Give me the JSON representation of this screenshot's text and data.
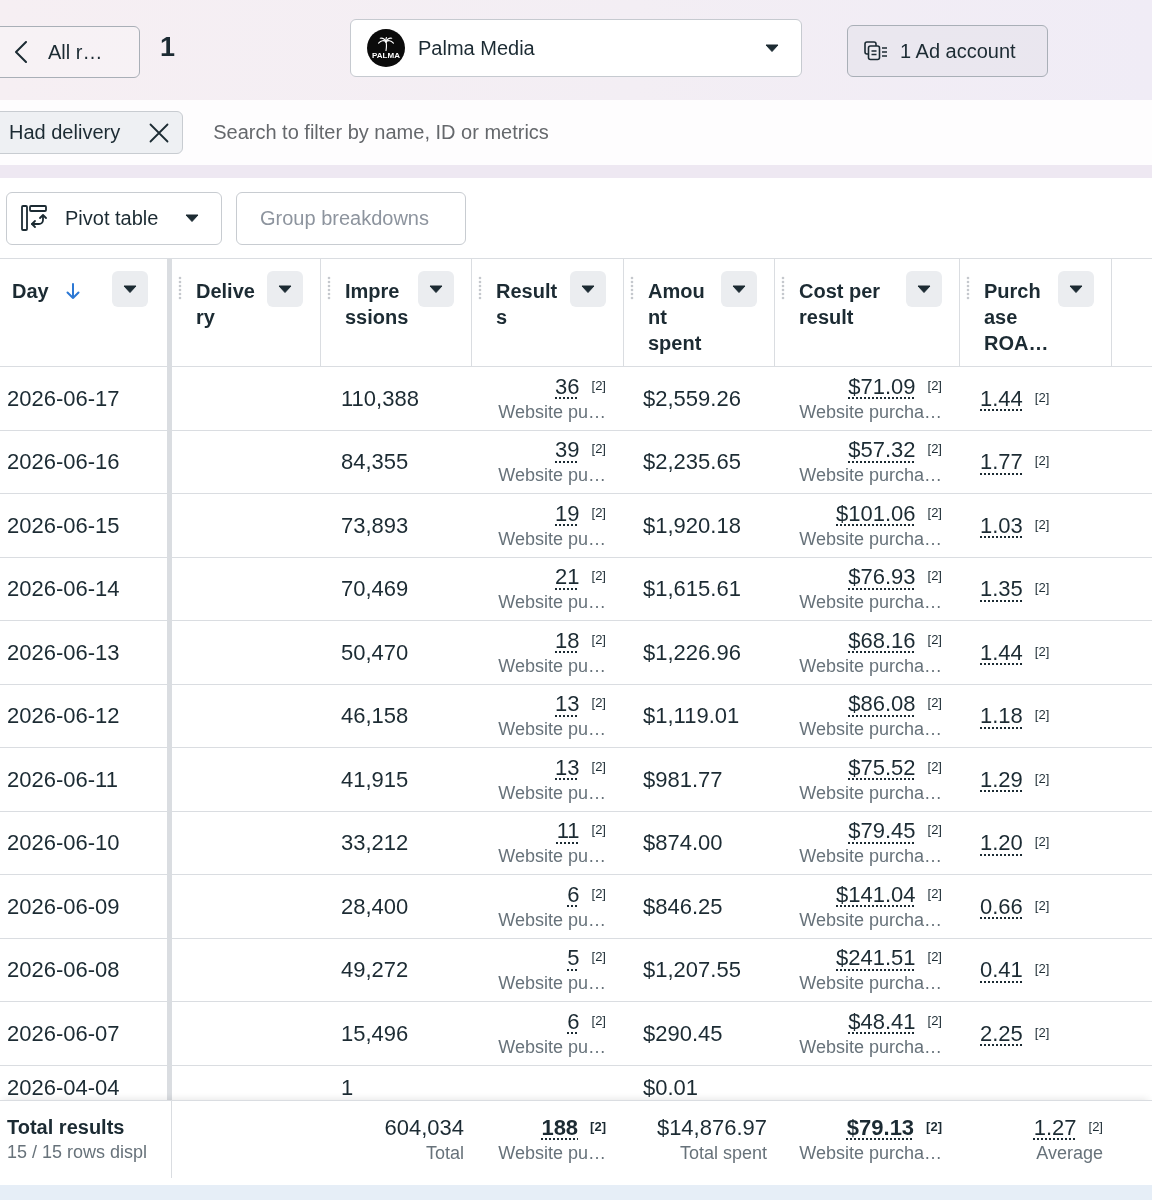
{
  "top_bar": {
    "back_button": {
      "label": "All r…"
    },
    "count": "1",
    "account_picker": {
      "logo_text": "PALMA",
      "name": "Palma Media"
    },
    "ad_account_button": {
      "label": "1 Ad account"
    }
  },
  "filter_bar": {
    "chips": [
      {
        "label": "Had delivery"
      }
    ],
    "search": {
      "placeholder": "Search to filter by name, ID or metrics"
    }
  },
  "toolbar": {
    "pivot_button": {
      "label": "Pivot table"
    },
    "group_button": {
      "label": "Group breakdowns",
      "disabled": true
    }
  },
  "table": {
    "columns": [
      {
        "label": "Day",
        "sorted_descending": true
      },
      {
        "label": "Delivery"
      },
      {
        "label": "Impressions"
      },
      {
        "label": "Results"
      },
      {
        "label": "Amount spent"
      },
      {
        "label": "Cost per result"
      },
      {
        "label": "Purchase ROA…"
      }
    ],
    "rows": [
      {
        "day": "2026-06-17",
        "impressions": "110,388",
        "results": {
          "value": "36",
          "note": "[2]",
          "label": "Website pu…"
        },
        "amount_spent": "$2,559.26",
        "cost_per_result": {
          "value": "$71.09",
          "note": "[2]",
          "label": "Website purcha…"
        },
        "purchase_roas": {
          "value": "1.44",
          "note": "[2]"
        }
      },
      {
        "day": "2026-06-16",
        "impressions": "84,355",
        "results": {
          "value": "39",
          "note": "[2]",
          "label": "Website pu…"
        },
        "amount_spent": "$2,235.65",
        "cost_per_result": {
          "value": "$57.32",
          "note": "[2]",
          "label": "Website purcha…"
        },
        "purchase_roas": {
          "value": "1.77",
          "note": "[2]"
        }
      },
      {
        "day": "2026-06-15",
        "impressions": "73,893",
        "results": {
          "value": "19",
          "note": "[2]",
          "label": "Website pu…"
        },
        "amount_spent": "$1,920.18",
        "cost_per_result": {
          "value": "$101.06",
          "note": "[2]",
          "label": "Website purcha…"
        },
        "purchase_roas": {
          "value": "1.03",
          "note": "[2]"
        }
      },
      {
        "day": "2026-06-14",
        "impressions": "70,469",
        "results": {
          "value": "21",
          "note": "[2]",
          "label": "Website pu…"
        },
        "amount_spent": "$1,615.61",
        "cost_per_result": {
          "value": "$76.93",
          "note": "[2]",
          "label": "Website purcha…"
        },
        "purchase_roas": {
          "value": "1.35",
          "note": "[2]"
        }
      },
      {
        "day": "2026-06-13",
        "impressions": "50,470",
        "results": {
          "value": "18",
          "note": "[2]",
          "label": "Website pu…"
        },
        "amount_spent": "$1,226.96",
        "cost_per_result": {
          "value": "$68.16",
          "note": "[2]",
          "label": "Website purcha…"
        },
        "purchase_roas": {
          "value": "1.44",
          "note": "[2]"
        }
      },
      {
        "day": "2026-06-12",
        "impressions": "46,158",
        "results": {
          "value": "13",
          "note": "[2]",
          "label": "Website pu…"
        },
        "amount_spent": "$1,119.01",
        "cost_per_result": {
          "value": "$86.08",
          "note": "[2]",
          "label": "Website purcha…"
        },
        "purchase_roas": {
          "value": "1.18",
          "note": "[2]"
        }
      },
      {
        "day": "2026-06-11",
        "impressions": "41,915",
        "results": {
          "value": "13",
          "note": "[2]",
          "label": "Website pu…"
        },
        "amount_spent": "$981.77",
        "cost_per_result": {
          "value": "$75.52",
          "note": "[2]",
          "label": "Website purcha…"
        },
        "purchase_roas": {
          "value": "1.29",
          "note": "[2]"
        }
      },
      {
        "day": "2026-06-10",
        "impressions": "33,212",
        "results": {
          "value": "11",
          "note": "[2]",
          "label": "Website pu…"
        },
        "amount_spent": "$874.00",
        "cost_per_result": {
          "value": "$79.45",
          "note": "[2]",
          "label": "Website purcha…"
        },
        "purchase_roas": {
          "value": "1.20",
          "note": "[2]"
        }
      },
      {
        "day": "2026-06-09",
        "impressions": "28,400",
        "results": {
          "value": "6",
          "note": "[2]",
          "label": "Website pu…"
        },
        "amount_spent": "$846.25",
        "cost_per_result": {
          "value": "$141.04",
          "note": "[2]",
          "label": "Website purcha…"
        },
        "purchase_roas": {
          "value": "0.66",
          "note": "[2]"
        }
      },
      {
        "day": "2026-06-08",
        "impressions": "49,272",
        "results": {
          "value": "5",
          "note": "[2]",
          "label": "Website pu…"
        },
        "amount_spent": "$1,207.55",
        "cost_per_result": {
          "value": "$241.51",
          "note": "[2]",
          "label": "Website purcha…"
        },
        "purchase_roas": {
          "value": "0.41",
          "note": "[2]"
        }
      },
      {
        "day": "2026-06-07",
        "impressions": "15,496",
        "results": {
          "value": "6",
          "note": "[2]",
          "label": "Website pu…"
        },
        "amount_spent": "$290.45",
        "cost_per_result": {
          "value": "$48.41",
          "note": "[2]",
          "label": "Website purcha…"
        },
        "purchase_roas": {
          "value": "2.25",
          "note": "[2]"
        }
      }
    ],
    "partial_row": {
      "day": "2026-04-04",
      "impressions": "1",
      "amount_spent": "$0.01"
    },
    "totals": {
      "label": "Total results",
      "rows_note": "15 / 15 rows displ",
      "impressions": {
        "value": "604,034",
        "caption": "Total"
      },
      "results": {
        "value": "188",
        "note": "[2]",
        "caption": "Website pu…"
      },
      "amount_spent": {
        "value": "$14,876.97",
        "caption": "Total spent"
      },
      "cost_per_result": {
        "value": "$79.13",
        "note": "[2]",
        "caption": "Website purcha…"
      },
      "purchase_roas": {
        "value": "1.27",
        "note": "[2]",
        "caption": "Average"
      }
    }
  }
}
